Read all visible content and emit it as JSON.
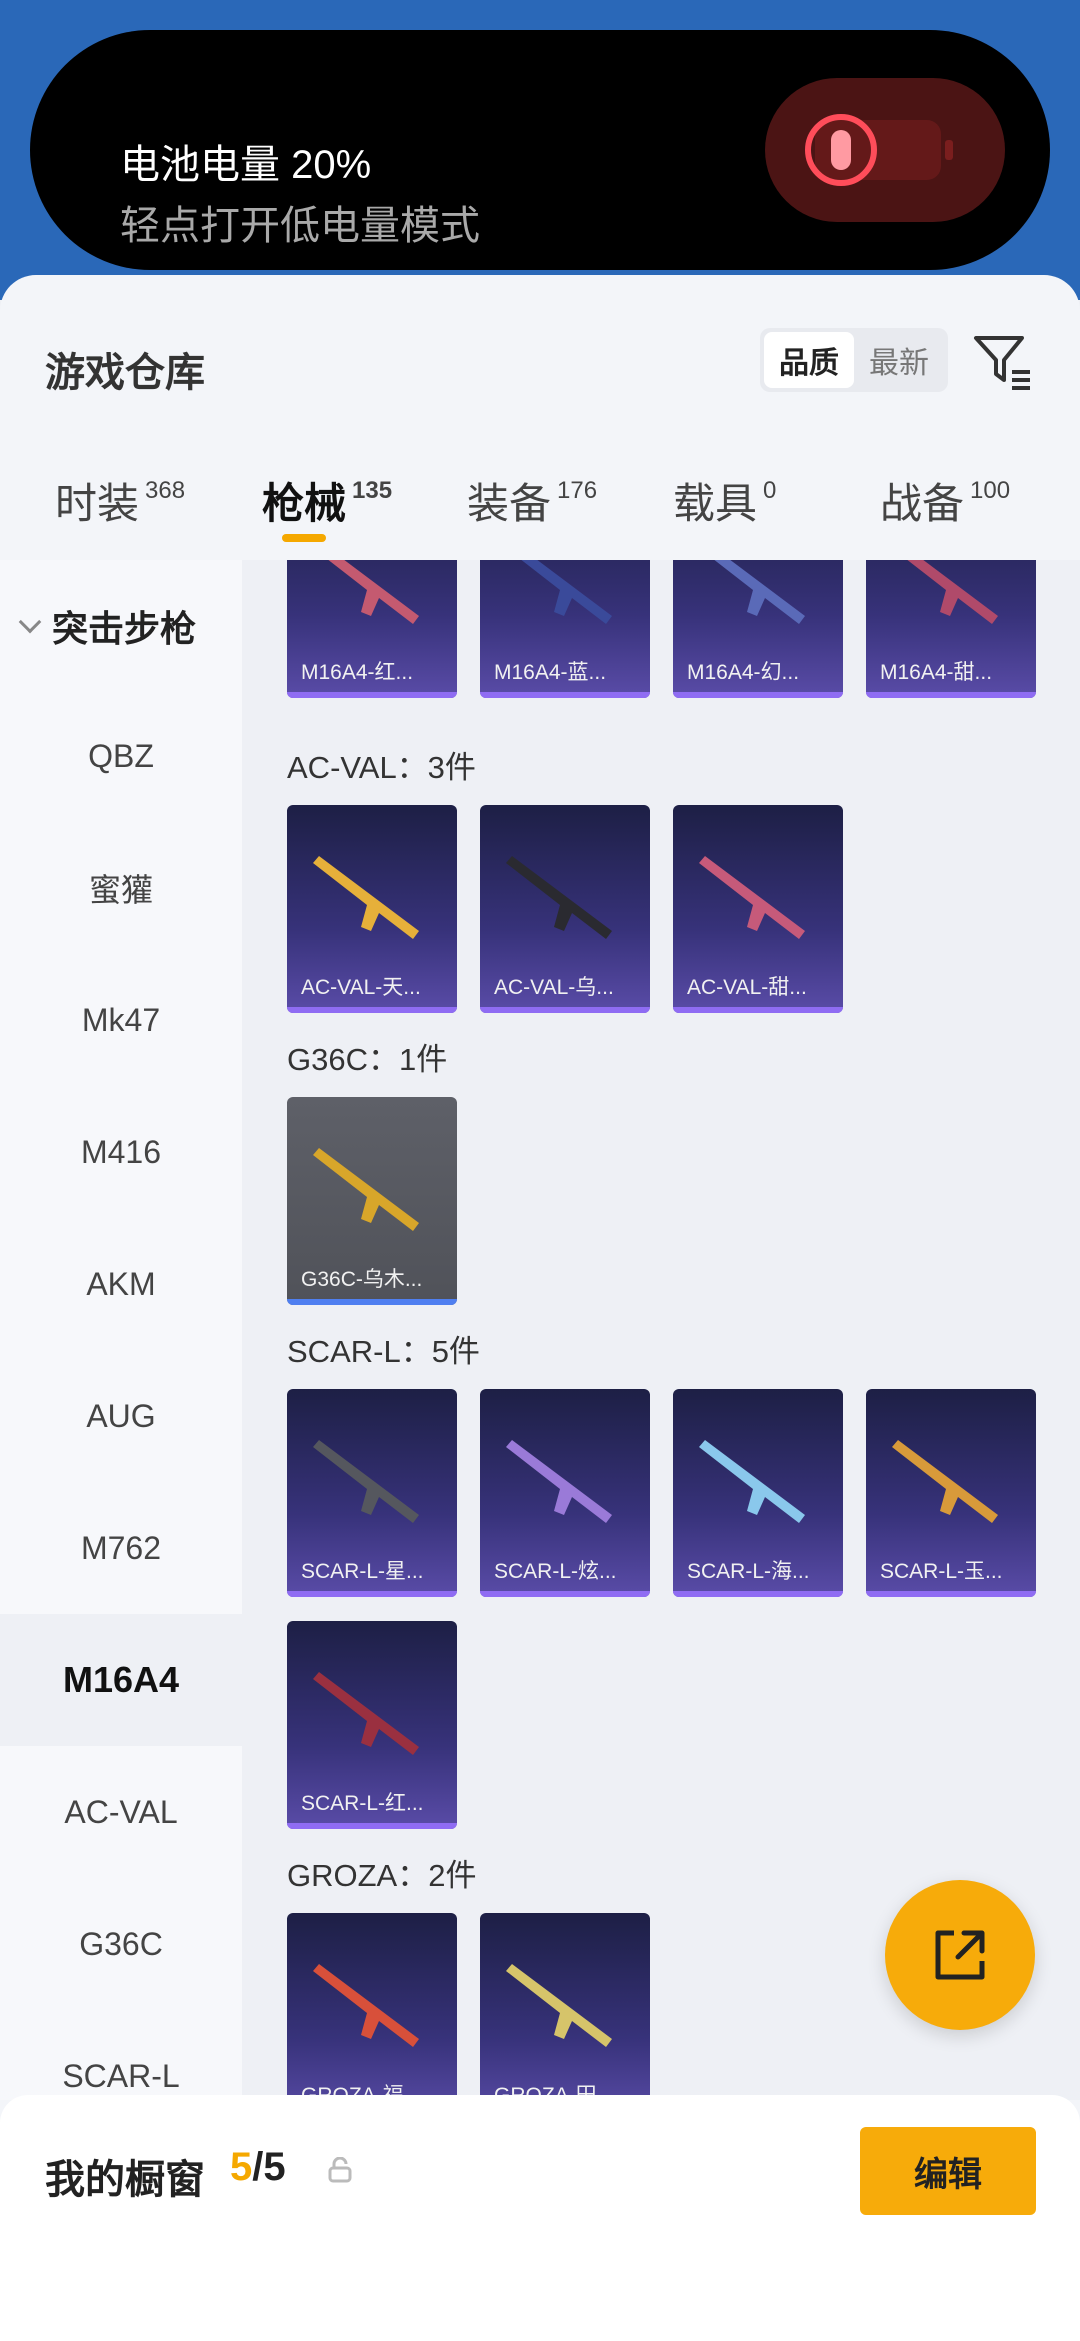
{
  "battery_banner": {
    "title": "电池电量 20%",
    "subtitle": "轻点打开低电量模式"
  },
  "header": {
    "title": "游戏仓库",
    "sort_options": [
      "品质",
      "最新"
    ],
    "sort_selected": "品质",
    "filter_icon": "filter-icon"
  },
  "tabs": [
    {
      "label": "时装",
      "count": "368"
    },
    {
      "label": "枪械",
      "count": "135",
      "active": true
    },
    {
      "label": "装备",
      "count": "176"
    },
    {
      "label": "载具",
      "count": "0"
    },
    {
      "label": "战备",
      "count": "100"
    }
  ],
  "sidebar": {
    "section": "突击步枪",
    "items": [
      "QBZ",
      "蜜獾",
      "Mk47",
      "M416",
      "AKM",
      "AUG",
      "M762",
      "M16A4",
      "AC-VAL",
      "G36C",
      "SCAR-L"
    ],
    "selected": "M16A4"
  },
  "groups": [
    {
      "title": "",
      "items": [
        "M16A4-红...",
        "M16A4-蓝...",
        "M16A4-幻...",
        "M16A4-甜..."
      ]
    },
    {
      "title": "AC-VAL：3件",
      "items": [
        "AC-VAL-天...",
        "AC-VAL-乌...",
        "AC-VAL-甜..."
      ]
    },
    {
      "title": "G36C：1件",
      "items": [
        "G36C-乌木..."
      ]
    },
    {
      "title": "SCAR-L：5件",
      "items": [
        "SCAR-L-星...",
        "SCAR-L-炫...",
        "SCAR-L-海...",
        "SCAR-L-玉...",
        "SCAR-L-红..."
      ]
    },
    {
      "title": "GROZA：2件",
      "items": [
        "GROZA-福...",
        "GROZA-田..."
      ]
    }
  ],
  "bottom_bar": {
    "label": "我的橱窗",
    "count_current": "5",
    "count_total": "/5",
    "edit_label": "编辑"
  },
  "colors": {
    "accent": "#f7ab0a",
    "card_bar": "#8f6cf3"
  }
}
